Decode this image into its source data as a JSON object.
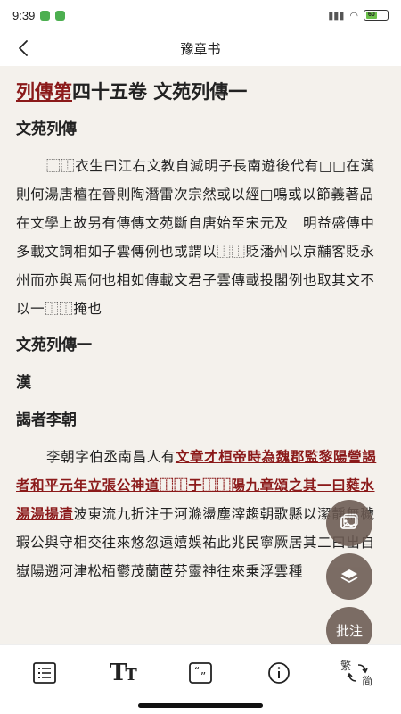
{
  "status": {
    "time": "9:39",
    "network": "ᴴᴰ",
    "battery": "60"
  },
  "nav": {
    "title": "豫章书"
  },
  "article": {
    "heading_link": "列傳第",
    "heading_rest": "四十五卷 文苑列傳一",
    "section1": "文苑列傳",
    "para1": "⿰⿰衣生曰江右文教自減明子長南遊後代有□□在漢則何湯唐檀在晉則陶潛雷次宗然或以經□鳴或以節義著品在文學上故另有傳傳文苑斷自唐始至宋元及　明益盛傳中多載文詞相如子雲傳例也或謂以⿰⿰貶潘州以京黼客貶永州而亦與焉何也相如傳載文君子雲傳載投閣例也取其文不以一⿰⿰掩也",
    "section2": "文苑列傳一",
    "section3": "漢",
    "section4": "謁者李朝",
    "para2_a": "李朝字伯丞南昌人有",
    "para2_link1": "文章才桓帝時為魏郡監黎陽營謁者和平元年立張公神道⿰⿰于⿰⿰陽",
    "para2_b": "",
    "para2_link2": "九章頌之其一曰蕤水湯湯揚清",
    "para2_c": "波東流九折注于河滌盪塵滓趨朝歌縣以潔靜無穢瑕公與守相交往來悠忽遠嬉娛祐此兆民寧厥居其二曰出自嶽陽遡河津松栢鬱茂蘭茝芬靈神往來乗浮雲種"
  },
  "fabs": {
    "annotate_label": "批注"
  },
  "toolbar": {
    "convert_trad": "繁",
    "convert_simp": "简"
  }
}
